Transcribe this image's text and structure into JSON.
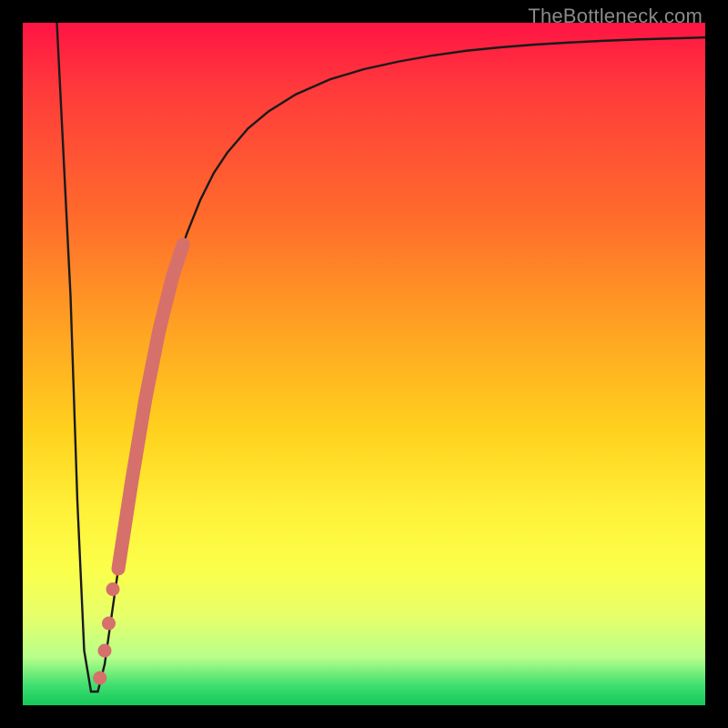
{
  "attribution": "TheBottleneck.com",
  "chart_data": {
    "type": "line",
    "title": "",
    "xlabel": "",
    "ylabel": "",
    "xlim": [
      0,
      100
    ],
    "ylim": [
      0,
      100
    ],
    "curve": {
      "x": [
        5,
        7,
        8,
        9,
        10,
        11,
        12,
        14,
        16,
        18,
        20,
        22,
        24,
        26,
        28,
        30,
        33,
        36,
        40,
        45,
        50,
        55,
        60,
        65,
        70,
        75,
        80,
        85,
        90,
        95,
        100
      ],
      "y": [
        100,
        60,
        30,
        8,
        2,
        2,
        6,
        20,
        33,
        45,
        55,
        63,
        69,
        74,
        78,
        81,
        84.5,
        87,
        89.5,
        91.7,
        93.2,
        94.3,
        95.2,
        95.9,
        96.4,
        96.8,
        97.1,
        97.35,
        97.55,
        97.7,
        97.85
      ]
    },
    "highlight_band": {
      "x": [
        14.0,
        23.5
      ],
      "y": [
        22,
        67
      ]
    },
    "highlight_dots": [
      {
        "x": 13.2,
        "y": 17
      },
      {
        "x": 12.6,
        "y": 12
      },
      {
        "x": 12.0,
        "y": 8
      },
      {
        "x": 11.3,
        "y": 4
      }
    ],
    "colors": {
      "curve": "#1a1a1a",
      "highlight": "#d6706b"
    }
  }
}
